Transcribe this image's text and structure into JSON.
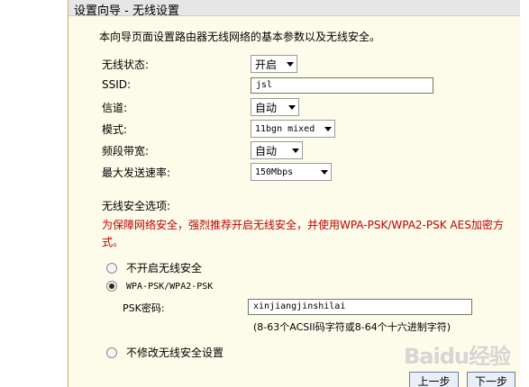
{
  "header": {
    "title": "设置向导 - 无线设置"
  },
  "intro_text": "本向导页面设置路由器无线网络的基本参数以及无线安全。",
  "form": {
    "wireless_status": {
      "label": "无线状态:",
      "value": "开启"
    },
    "ssid": {
      "label": "SSID:",
      "value": "jsl"
    },
    "channel": {
      "label": "信道:",
      "value": "自动"
    },
    "mode": {
      "label": "模式:",
      "value": "11bgn mixed"
    },
    "bandwidth": {
      "label": "频段带宽:",
      "value": "自动"
    },
    "max_rate": {
      "label": "最大发送速率:",
      "value": "150Mbps"
    }
  },
  "security": {
    "title": "无线安全选项:",
    "warning": "为保障网络安全，强烈推荐开启无线安全，并使用WPA-PSK/WPA2-PSK AES加密方式。",
    "options": [
      {
        "label": "不开启无线安全",
        "checked": false
      },
      {
        "label": "WPA-PSK/WPA2-PSK",
        "checked": true
      },
      {
        "label": "不修改无线安全设置",
        "checked": false
      }
    ],
    "psk_label": "PSK密码:",
    "psk_value": "xinjiangjinshilai",
    "psk_hint": "(8-63个ACSII码字符或8-64个十六进制字符)"
  },
  "buttons": {
    "prev": "上一步",
    "next": "下一步"
  },
  "watermark": {
    "text": "Baidu",
    "suffix": "经验"
  },
  "icons": {
    "caret": "chevron-down-icon",
    "radio": "radio-icon"
  },
  "colors": {
    "panel_bg": "#fdfbe9",
    "panel_border": "#c8a86e",
    "warning": "#c00000"
  }
}
